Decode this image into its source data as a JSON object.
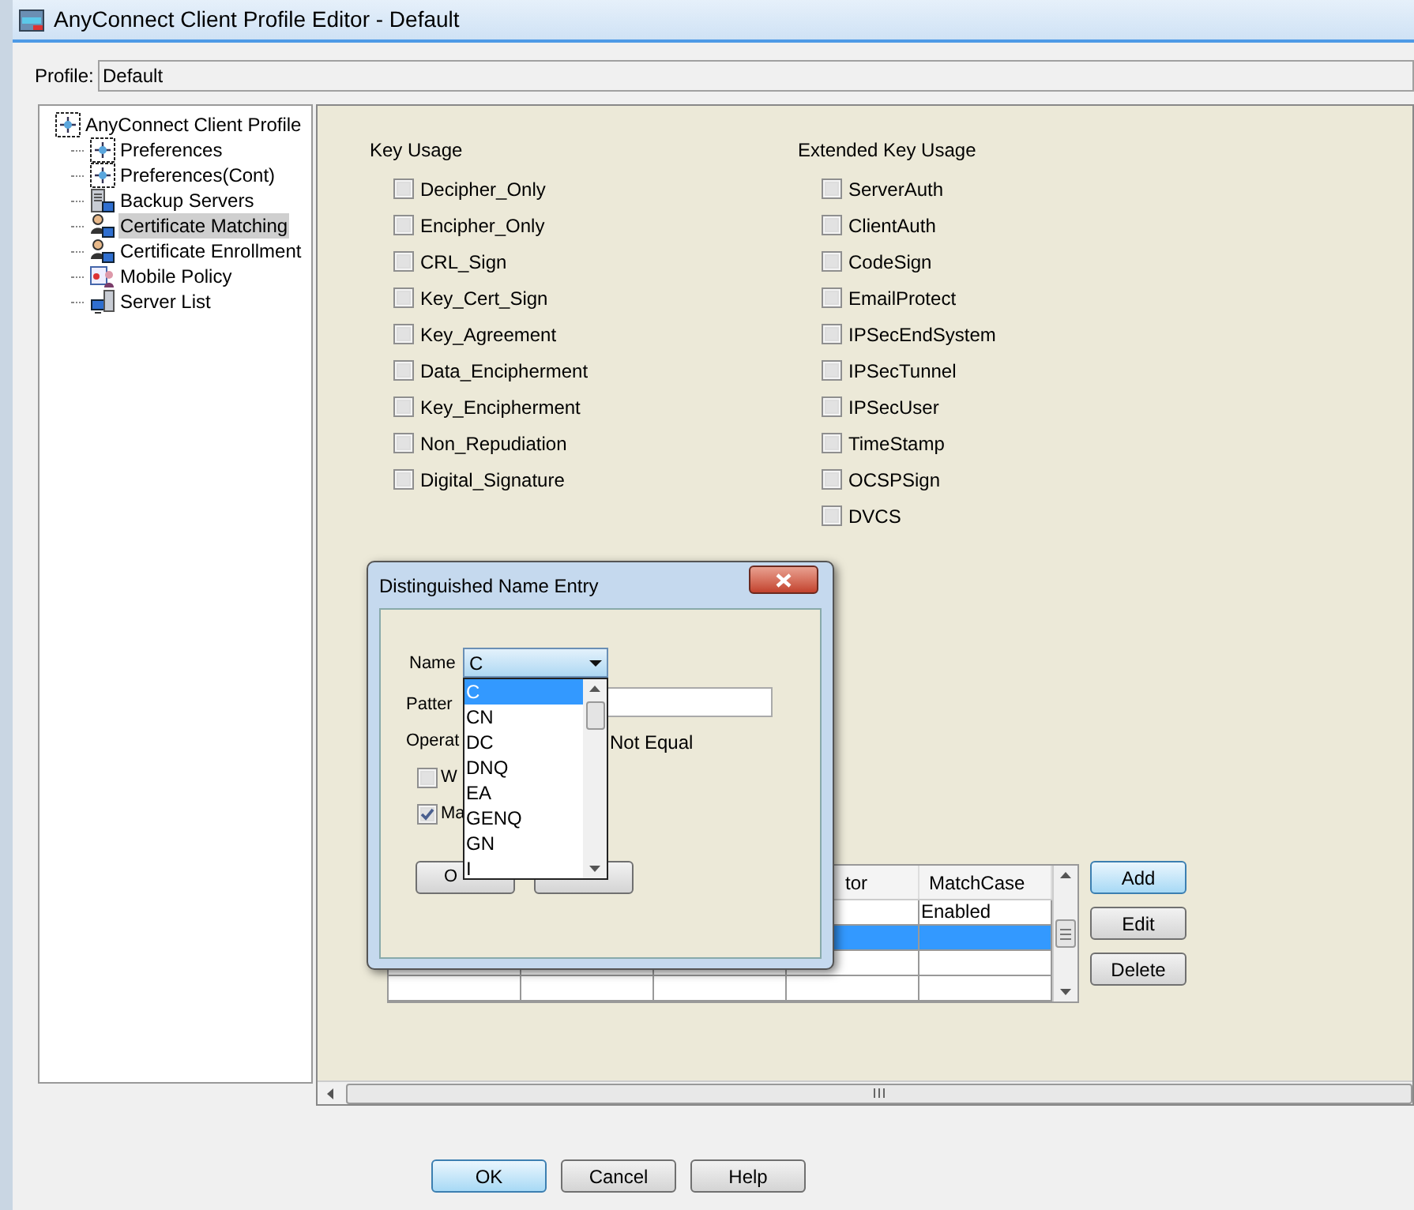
{
  "window": {
    "title": "AnyConnect Client Profile Editor - Default"
  },
  "profile": {
    "label": "Profile:",
    "value": "Default"
  },
  "tree": {
    "items": [
      {
        "label": "AnyConnect Client Profile",
        "kind": "network",
        "selected": false,
        "children": [
          {
            "label": "Preferences",
            "kind": "network",
            "selected": false
          },
          {
            "label": "Preferences(Cont)",
            "kind": "network",
            "selected": false
          },
          {
            "label": "Backup Servers",
            "kind": "server",
            "selected": false
          },
          {
            "label": "Certificate Matching",
            "kind": "users",
            "selected": true
          },
          {
            "label": "Certificate Enrollment",
            "kind": "users",
            "selected": false
          },
          {
            "label": "Mobile Policy",
            "kind": "mobile",
            "selected": false
          },
          {
            "label": "Server List",
            "kind": "computer",
            "selected": false
          }
        ]
      }
    ]
  },
  "key_usage": {
    "title": "Key Usage",
    "options": [
      {
        "label": "Decipher_Only",
        "checked": false
      },
      {
        "label": "Encipher_Only",
        "checked": false
      },
      {
        "label": "CRL_Sign",
        "checked": false
      },
      {
        "label": "Key_Cert_Sign",
        "checked": false
      },
      {
        "label": "Key_Agreement",
        "checked": false
      },
      {
        "label": "Data_Encipherment",
        "checked": false
      },
      {
        "label": "Key_Encipherment",
        "checked": false
      },
      {
        "label": "Non_Repudiation",
        "checked": false
      },
      {
        "label": "Digital_Signature",
        "checked": false
      }
    ]
  },
  "extended_key_usage": {
    "title": "Extended Key Usage",
    "options": [
      {
        "label": "ServerAuth",
        "checked": false
      },
      {
        "label": "ClientAuth",
        "checked": false
      },
      {
        "label": "CodeSign",
        "checked": false
      },
      {
        "label": "EmailProtect",
        "checked": false
      },
      {
        "label": "IPSecEndSystem",
        "checked": false
      },
      {
        "label": "IPSecTunnel",
        "checked": false
      },
      {
        "label": "IPSecUser",
        "checked": false
      },
      {
        "label": "TimeStamp",
        "checked": false
      },
      {
        "label": "OCSPSign",
        "checked": false
      },
      {
        "label": "DVCS",
        "checked": false
      }
    ]
  },
  "table": {
    "column_4": "tor",
    "column_5": "MatchCase",
    "rows": [
      {
        "column_5": "Enabled",
        "selected": false
      },
      {
        "selected": true
      },
      {
        "selected": false
      },
      {
        "selected": false
      }
    ]
  },
  "side_buttons": [
    {
      "label": "Add",
      "focused": true
    },
    {
      "label": "Edit",
      "focused": false
    },
    {
      "label": "Delete",
      "focused": false
    }
  ],
  "buttons": [
    {
      "label": "OK",
      "focused": true
    },
    {
      "label": "Cancel",
      "focused": false
    },
    {
      "label": "Help",
      "focused": false
    }
  ],
  "dialog": {
    "title": "Distinguished Name Entry",
    "name_label": "Name",
    "name_value": "C",
    "name_options": [
      {
        "label": "C",
        "selected": true
      },
      {
        "label": "CN",
        "selected": false
      },
      {
        "label": "DC",
        "selected": false
      },
      {
        "label": "DNQ",
        "selected": false
      },
      {
        "label": "EA",
        "selected": false
      },
      {
        "label": "GENQ",
        "selected": false
      },
      {
        "label": "GN",
        "selected": false
      },
      {
        "label": "I",
        "selected": false
      }
    ],
    "pattern_label": "Patter",
    "operator_label": "Operat",
    "operator_option": "Not Equal",
    "checkboxes": [
      {
        "label": "W",
        "checked": false
      },
      {
        "label": "Ma",
        "checked": true
      }
    ],
    "buttons": [
      "O"
    ]
  }
}
